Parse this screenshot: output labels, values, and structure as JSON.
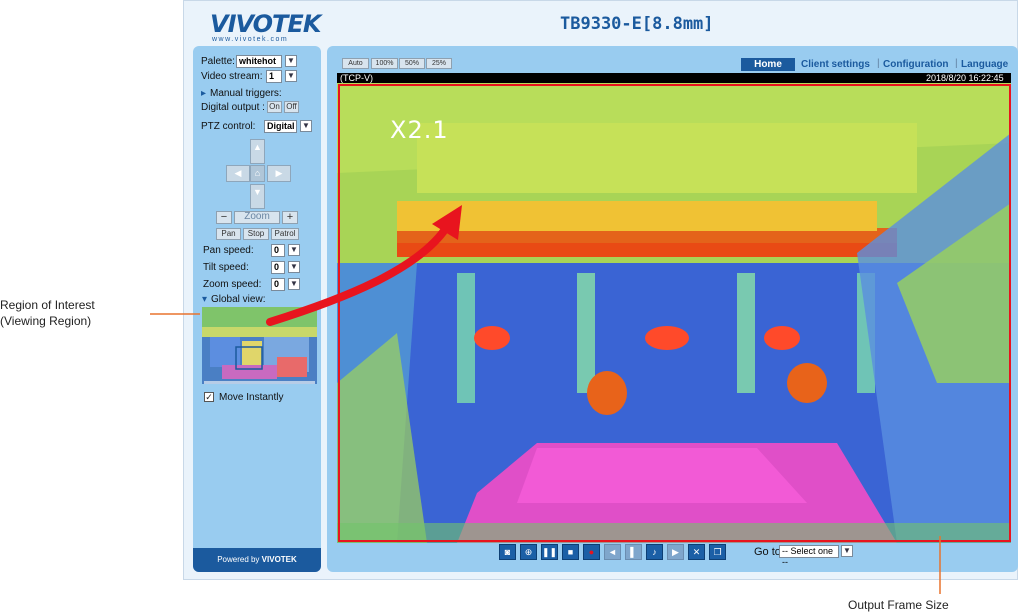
{
  "camera_title": "TB9330-E[8.8mm]",
  "brand": {
    "name": "VIVOTEK",
    "url": "www.vivotek.com",
    "powered_by": "Powered by",
    "powered_brand": "VIVOTEK"
  },
  "view_sizes": [
    "Auto",
    "100%",
    "50%",
    "25%"
  ],
  "nav": {
    "home": "Home",
    "client_settings": "Client settings",
    "configuration": "Configuration",
    "language": "Language"
  },
  "stream_bar": {
    "protocol": "(TCP-V)",
    "timestamp": "2018/8/20 16:22:45"
  },
  "zoom_overlay": "X2.1",
  "sidebar": {
    "palette_label": "Palette:",
    "palette_value": "whitehot",
    "video_stream_label": "Video stream:",
    "video_stream_value": "1",
    "manual_triggers": "Manual triggers:",
    "digital_output_label": "Digital output :",
    "on": "On",
    "off": "Off",
    "ptz_control_label": "PTZ control:",
    "ptz_control_value": "Digital",
    "zoom_label": "Zoom",
    "zoom_minus": "−",
    "zoom_plus": "+",
    "pan": "Pan",
    "stop": "Stop",
    "patrol": "Patrol",
    "pan_speed_label": "Pan speed:",
    "pan_speed_value": "0",
    "tilt_speed_label": "Tilt speed:",
    "tilt_speed_value": "0",
    "zoom_speed_label": "Zoom speed:",
    "zoom_speed_value": "0",
    "global_view": "Global view:",
    "move_instantly": "Move Instantly"
  },
  "bottom_controls": {
    "goto_label": "Go to",
    "goto_value": "-- Select one --"
  },
  "annotations": {
    "roi_line1": "Region of Interest",
    "roi_line2": "(Viewing Region)",
    "output_frame": "Output Frame Size"
  },
  "colors": {
    "brand_blue": "#1b5a9e",
    "panel_blue": "#99ccf0",
    "annotation_red": "#e8141e"
  }
}
